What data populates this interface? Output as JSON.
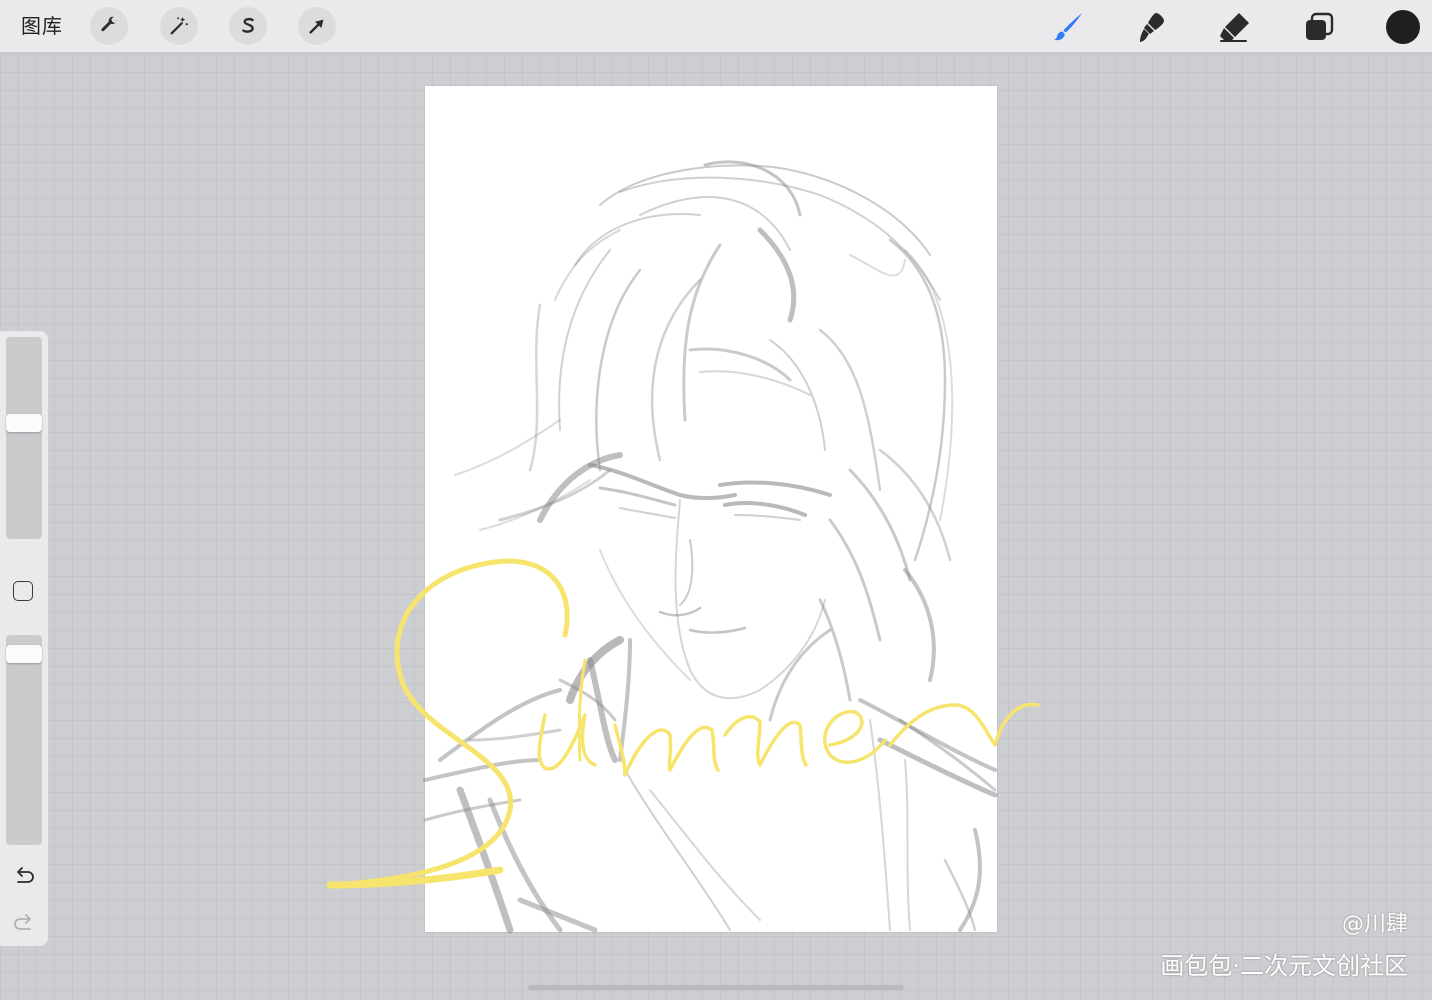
{
  "topbar": {
    "gallery_label": "图库",
    "left_tools": [
      {
        "name": "actions",
        "icon": "wrench-icon"
      },
      {
        "name": "adjustments",
        "icon": "magic-wand-icon"
      },
      {
        "name": "selection",
        "icon": "selection-s-icon"
      },
      {
        "name": "transform",
        "icon": "arrow-cursor-icon"
      }
    ],
    "right_tools": [
      {
        "name": "paint",
        "icon": "brush-icon",
        "active": true
      },
      {
        "name": "smudge",
        "icon": "smudge-icon"
      },
      {
        "name": "erase",
        "icon": "eraser-icon"
      },
      {
        "name": "layers",
        "icon": "layers-icon"
      }
    ],
    "current_color": "#1f1f1f",
    "active_tool_color": "#2f7cf6"
  },
  "sidebar": {
    "brush_size_level": 0.58,
    "opacity_level": 0.95,
    "modify_button": "square-icon",
    "undo_icon": "undo-icon",
    "redo_icon": "redo-icon"
  },
  "canvas": {
    "lettering": "Summer",
    "lettering_color": "#f7e46c",
    "sketch_color": "#8a8a8a"
  },
  "watermark": {
    "user": "@川肆",
    "site": "画包包·二次元文创社区"
  }
}
